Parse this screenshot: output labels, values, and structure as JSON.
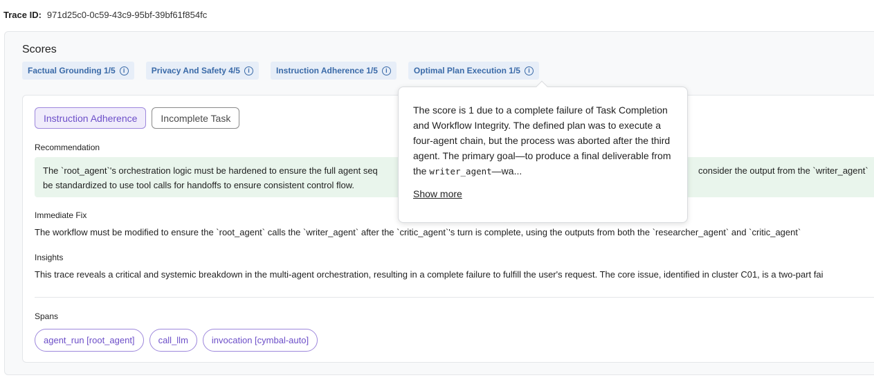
{
  "trace": {
    "label": "Trace ID:",
    "value": "971d25c0-0c59-43c9-95bf-39bf61f854fc"
  },
  "scores": {
    "title": "Scores",
    "chips": [
      {
        "label": "Factual Grounding 1/5"
      },
      {
        "label": "Privacy And Safety 4/5"
      },
      {
        "label": "Instruction Adherence 1/5"
      },
      {
        "label": "Optimal Plan Execution 1/5"
      }
    ]
  },
  "tags": [
    {
      "label": "Instruction Adherence",
      "active": true
    },
    {
      "label": "Incomplete Task",
      "active": false
    }
  ],
  "recommendation": {
    "label": "Recommendation",
    "line1": "The `root_agent`'s orchestration logic must be hardened to ensure the full agent seq",
    "line1_tail": "consider the output from the `writer_agent`",
    "line2": "be standardized to use tool calls for handoffs to ensure consistent control flow."
  },
  "immediate_fix": {
    "label": "Immediate Fix",
    "text": "The workflow must be modified to ensure the `root_agent` calls the `writer_agent` after the `critic_agent`'s turn is complete, using the outputs from both the `researcher_agent` and `critic_agent`"
  },
  "insights": {
    "label": "Insights",
    "text": "This trace reveals a critical and systemic breakdown in the multi-agent orchestration, resulting in a complete failure to fulfill the user's request. The core issue, identified in cluster C01, is a two-part fai"
  },
  "spans": {
    "label": "Spans",
    "items": [
      "agent_run [root_agent]",
      "call_llm",
      "invocation [cymbal-auto]"
    ]
  },
  "popover": {
    "text_before": "The score is 1 due to a complete failure of Task Completion and Workflow Integrity. The defined plan was to execute a four-agent chain, but the process was aborted after the third agent. The primary goal—to produce a final deliverable from the ",
    "code": "writer_agent",
    "text_after": "—wa...",
    "show_more": "Show more"
  },
  "colors": {
    "chip_bg": "#e7eef8",
    "chip_text": "#3a6aa8",
    "accent_purple": "#6c4ec8",
    "rec_bg": "#e9f5ec"
  }
}
